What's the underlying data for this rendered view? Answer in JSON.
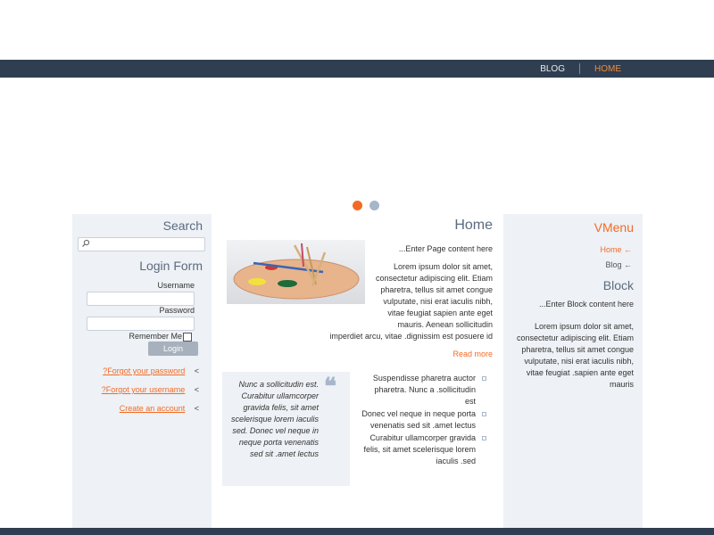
{
  "nav": {
    "items": [
      "BLOG",
      "HOME"
    ],
    "active": "HOME"
  },
  "left": {
    "search_title": "Search",
    "login_title": "Login Form",
    "username_label": "Username",
    "password_label": "Password",
    "remember_label": "Remember Me",
    "login_button": "Login",
    "links": [
      "?Forgot your password",
      "?Forgot your username",
      "Create an account"
    ],
    "arrow": "<"
  },
  "center": {
    "title": "Home",
    "intro": "...Enter Page content here",
    "body": "Lorem ipsum dolor sit amet, consectetur adipiscing elit. Etiam pharetra, tellus sit amet congue vulputate, nisi erat iaculis nibh, vitae feugiat sapien ante eget mauris. Aenean sollicitudin imperdiet arcu, vitae .dignissim est posuere id",
    "read_more": "Read more",
    "quote": "Nunc a sollicitudin est. Curabitur ullamcorper gravida felis, sit amet scelerisque lorem iaculis sed. Donec vel neque in neque porta venenatis sed sit .amet lectus",
    "quote_mark": "❝",
    "bullets": [
      "Suspendisse pharetra auctor pharetra. Nunc a .sollicitudin est",
      "Donec vel neque in neque porta venenatis sed sit .amet lectus",
      "Curabitur ullamcorper gravida felis, sit amet scelerisque lorem iaculis .sed"
    ]
  },
  "right": {
    "vmenu_title": "VMenu",
    "menu": [
      "Home ←",
      "Blog ←"
    ],
    "block_title": "Block",
    "block_intro": "...Enter Block content here",
    "block_body": "Lorem ipsum dolor sit amet, consectetur adipiscing elit. Etiam pharetra, tellus sit amet congue vulputate, nisi erat iaculis nibh, vitae feugiat .sapien ante eget mauris"
  },
  "colors": {
    "accent": "#f26b26",
    "bar": "#2f3e50",
    "panel": "#eef1f5"
  },
  "icons": {
    "search": "search-icon",
    "quote": "quote-icon"
  }
}
